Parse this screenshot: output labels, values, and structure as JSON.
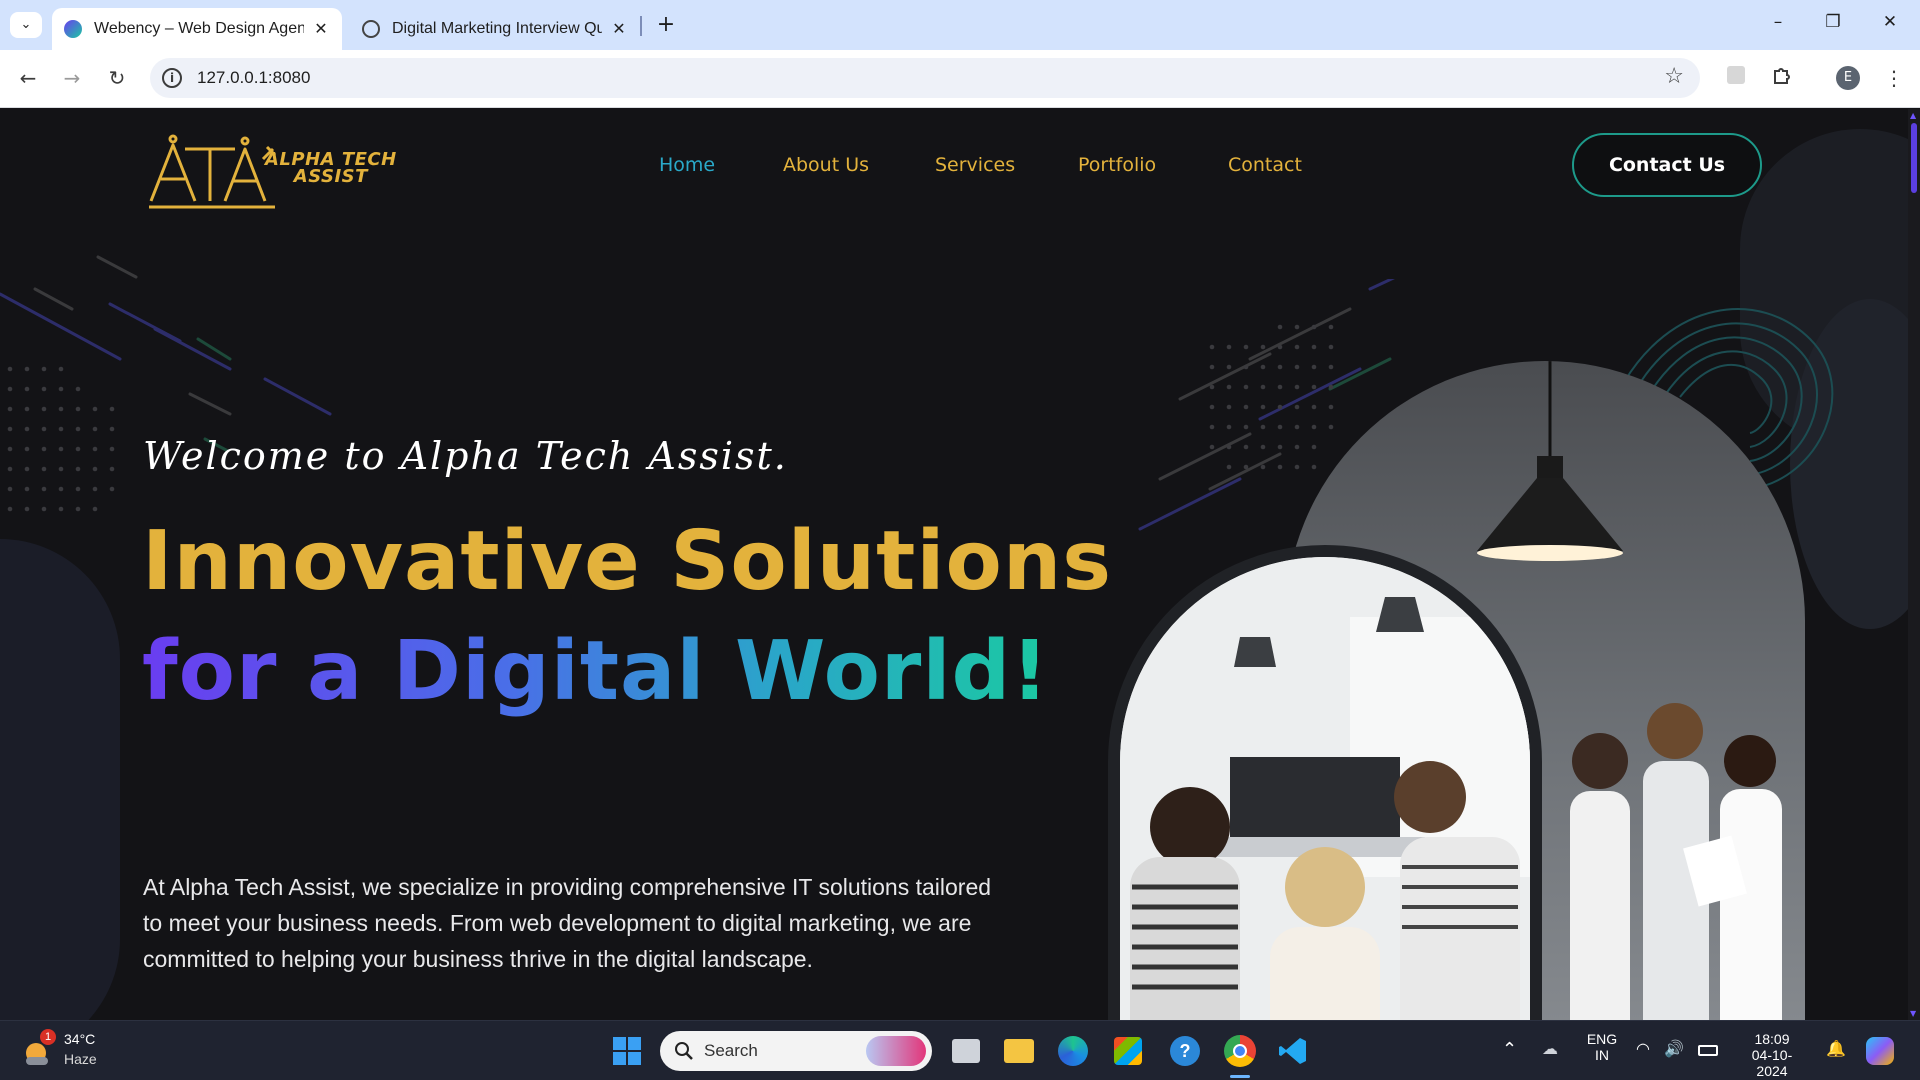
{
  "browser": {
    "tabs": [
      {
        "title": "Webency – Web Design Agency",
        "active": true
      },
      {
        "title": "Digital Marketing Interview Que",
        "active": false
      }
    ],
    "url": "127.0.0.1:8080",
    "profile_initial": "E"
  },
  "site": {
    "logo_text_line1": "ALPHA TECH",
    "logo_text_line2": "ASSIST",
    "nav": [
      {
        "label": "Home",
        "active": true
      },
      {
        "label": "About Us",
        "active": false
      },
      {
        "label": "Services",
        "active": false
      },
      {
        "label": "Portfolio",
        "active": false
      },
      {
        "label": "Contact",
        "active": false
      }
    ],
    "cta_label": "Contact Us",
    "hero": {
      "welcome": "Welcome to Alpha Tech Assist.",
      "headline_line1": "Innovative Solutions",
      "headline_line2": "for a Digital World!",
      "intro_line1": "At Alpha Tech Assist, we specialize in providing comprehensive IT solutions tailored",
      "intro_line2": "to meet your business needs. From web development to digital marketing, we are",
      "intro_line3": "committed to helping your business thrive in the digital landscape."
    },
    "colors": {
      "gold": "#e3b23c",
      "teal": "#2aa9c9",
      "purple": "#6a3df0",
      "green": "#1bc9a2",
      "background": "#131316"
    }
  },
  "taskbar": {
    "weather_temp": "34°C",
    "weather_cond": "Haze",
    "weather_badge": "1",
    "search_label": "Search",
    "lang_line1": "ENG",
    "lang_line2": "IN",
    "time": "18:09",
    "date": "04-10-2024"
  }
}
